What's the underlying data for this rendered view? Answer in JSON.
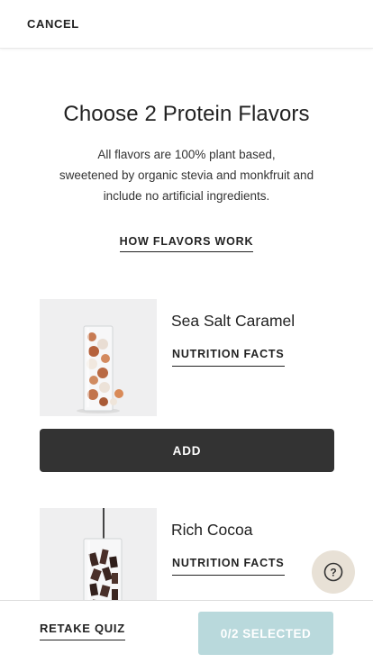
{
  "header": {
    "cancel_label": "CANCEL"
  },
  "intro": {
    "title": "Choose 2 Protein Flavors",
    "subtitle_line1": "All flavors are 100% plant based,",
    "subtitle_line2": "sweetened by organic stevia and monkfruit and",
    "subtitle_line3": "include no artificial ingredients.",
    "how_link": "HOW FLAVORS WORK"
  },
  "products": [
    {
      "name": "Sea Salt Caramel",
      "nutrition_label": "NUTRITION FACTS",
      "add_label": "ADD",
      "image_icon": "caramel-glass-image"
    },
    {
      "name": "Rich Cocoa",
      "nutrition_label": "NUTRITION FACTS",
      "image_icon": "cocoa-glass-image"
    }
  ],
  "help": {
    "icon": "question-icon",
    "glyph": "?"
  },
  "footer": {
    "retake_label": "RETAKE QUIZ",
    "selected_label": "0/2 SELECTED"
  },
  "colors": {
    "add_button": "#333333",
    "selected_button": "#b9d9dc",
    "help_bubble": "#e8e1d6"
  }
}
